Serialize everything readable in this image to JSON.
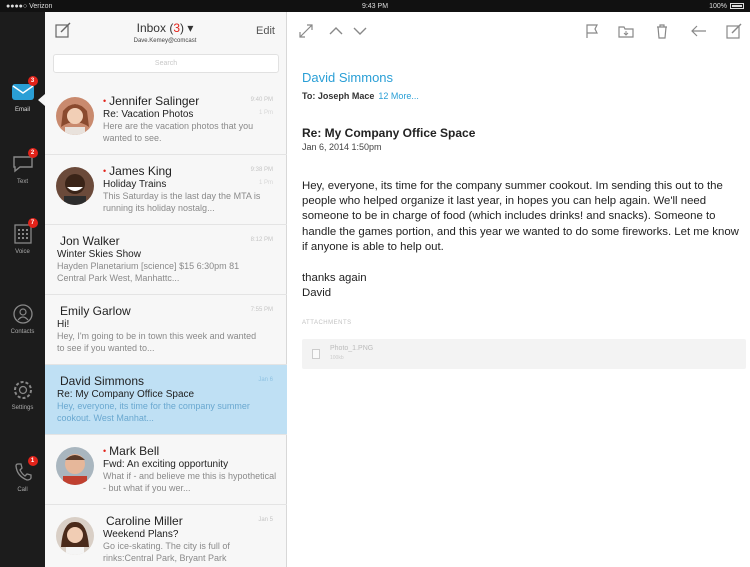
{
  "status_bar": {
    "carrier": "●●●●○ Verizon",
    "time": "9:43 PM",
    "battery": "100%"
  },
  "nav": {
    "items": [
      {
        "label": "Email",
        "badge": "3"
      },
      {
        "label": "Text",
        "badge": "2"
      },
      {
        "label": "Voice",
        "badge": "7"
      },
      {
        "label": "Contacts",
        "badge": ""
      },
      {
        "label": "Settings",
        "badge": ""
      },
      {
        "label": "Call",
        "badge": "1"
      }
    ]
  },
  "inbox": {
    "title": "Inbox (",
    "count": "3",
    "title_suffix": ") ▾",
    "account": "Dave.Kemey@comcast",
    "edit_label": "Edit",
    "search_placeholder": "Search",
    "messages": [
      {
        "sender": "Jennifer Salinger",
        "unread": "•",
        "subject": "Re: Vacation Photos",
        "preview": "Here are the vacation photos that you wanted to see.",
        "time": "9:40 PM",
        "sub_time": "1 Pm"
      },
      {
        "sender": "James King",
        "unread": "•",
        "subject": "Holiday Trains",
        "preview": "This Saturday is the last day the MTA is running its holiday nostalg...",
        "time": "9:38 PM",
        "sub_time": "1 Pm"
      },
      {
        "sender": "Jon Walker",
        "unread": "",
        "subject": "Winter Skies Show",
        "preview": "Hayden Planetarium [science] $15 6:30pm 81 Central Park West, Manhattc...",
        "time": "8:12 PM",
        "sub_time": ""
      },
      {
        "sender": "Emily Garlow",
        "unread": "",
        "subject": "Hi!",
        "preview": "Hey, I'm going to be in town this week and wanted to see if you wanted to...",
        "time": "7:55 PM",
        "sub_time": ""
      },
      {
        "sender": "David Simmons",
        "unread": "",
        "subject": "Re: My Company Office Space",
        "preview": "Hey, everyone, its time for the company summer cookout. West Manhat...",
        "time": "Jan 6",
        "sub_time": ""
      },
      {
        "sender": "Mark Bell",
        "unread": "•",
        "subject": "Fwd: An exciting opportunity",
        "preview": "What if - and believe me this is hypothetical - but what if you wer...",
        "time": "",
        "sub_time": ""
      },
      {
        "sender": "Caroline Miller",
        "unread": "",
        "subject": "Weekend Plans?",
        "preview": "Go ice-skating. The city is full of rinks:Central Park, Bryant Park",
        "time": "Jan 5",
        "sub_time": ""
      }
    ]
  },
  "reading": {
    "from": "David Simmons",
    "to_label": "To:",
    "to_name": "Joseph Mace",
    "more": "12 More...",
    "subject": "Re: My Company Office Space",
    "date": "Jan 6, 2014 1:50pm",
    "body": "Hey, everyone, its time for the company summer cookout. Im sending this out to the people who helped organize it last year, in hopes you can help again. We'll need someone to be in charge of food (which includes drinks! and snacks). Someone to handle the games portion, and this year we wanted to do some fireworks. Let me know if anyone is able to help out.",
    "signoff": "thanks again",
    "signature": "David",
    "attachments_label": "ATTACHMENTS",
    "attachment_name": "Photo_1.PNG",
    "attachment_size": "100kb"
  },
  "colors": {
    "accent": "#2a9fd6",
    "badge": "#e2231a",
    "nav_bg": "#1c1c1c",
    "selected_row": "#bfe0f4"
  }
}
